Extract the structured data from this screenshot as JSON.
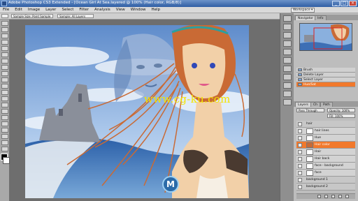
{
  "titlebar": {
    "title": "Adobe Photoshop CS3 Extended - [Ocean Girl At Sea.layered @ 100% (Hair color, RGB/8)]",
    "min": "_",
    "max": "□",
    "close": "×"
  },
  "menubar": {
    "items": [
      "File",
      "Edit",
      "Image",
      "Layer",
      "Select",
      "Filter",
      "Analysis",
      "View",
      "Window",
      "Help"
    ],
    "workspace_label": "Workspace ▾"
  },
  "options": {
    "sample_size": "Sample Size: Point Sample",
    "sample": "Sample: All Layers"
  },
  "watermark": "www.cg-ku.com",
  "logo_letter": "M",
  "panels": {
    "navigator_tabs": [
      "Navigator",
      "Info"
    ],
    "history_rows": [
      "Brush",
      "Delete Layer",
      "Select Layer",
      "Hue/Sat"
    ],
    "layers_tabs": [
      "Layers",
      "Ch",
      "Path"
    ],
    "blend_mode": "Pass Through",
    "opacity": "Opacity: 100%",
    "fill": "Fill: 100%",
    "layers": [
      {
        "name": "hair",
        "kind": "group"
      },
      {
        "name": "hair lines",
        "kind": "layer"
      },
      {
        "name": "Hue",
        "kind": "layer"
      },
      {
        "name": "Hair color",
        "kind": "layer",
        "selected": true
      },
      {
        "name": "Hair",
        "kind": "layer"
      },
      {
        "name": "Hair back",
        "kind": "layer"
      },
      {
        "name": "face - background",
        "kind": "layer"
      },
      {
        "name": "face",
        "kind": "layer"
      },
      {
        "name": "background 1",
        "kind": "group"
      },
      {
        "name": "background 2",
        "kind": "group"
      }
    ]
  },
  "colors": {
    "accent": "#f1792c",
    "sky": "#7ba3d6",
    "hair": "#c96a35",
    "skin": "#f2d0a8",
    "watermark": "#f4e400"
  }
}
